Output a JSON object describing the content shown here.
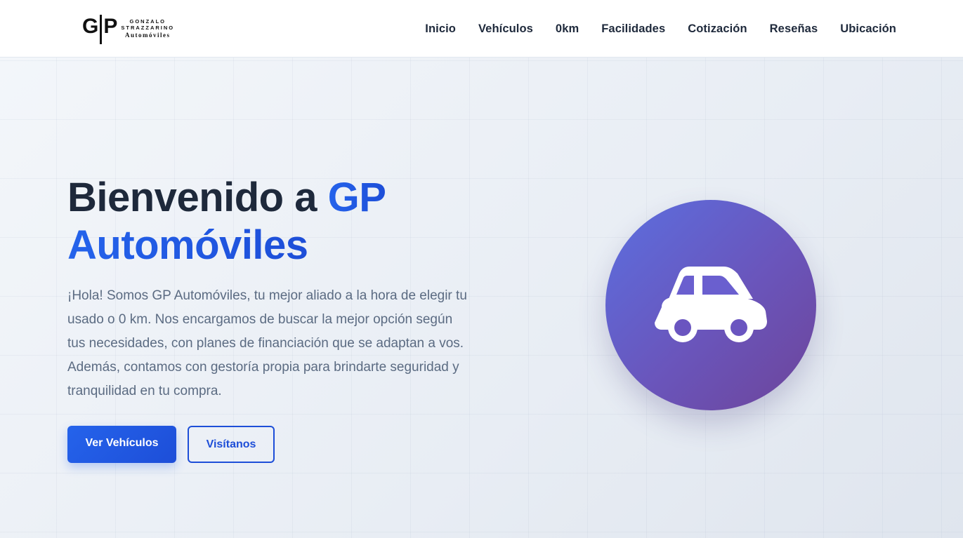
{
  "brand": {
    "mark_g": "G",
    "mark_p": "P",
    "line1": "GONZALO",
    "line2": "STRAZZARINO",
    "line3": "Automóviles"
  },
  "nav": {
    "items": [
      {
        "label": "Inicio"
      },
      {
        "label": "Vehículos"
      },
      {
        "label": "0km"
      },
      {
        "label": "Facilidades"
      },
      {
        "label": "Cotización"
      },
      {
        "label": "Reseñas"
      },
      {
        "label": "Ubicación"
      }
    ]
  },
  "hero": {
    "title_prefix": "Bienvenido a ",
    "title_accent_1": "GP",
    "title_accent_2": "Automóviles",
    "description": "¡Hola! Somos GP Automóviles, tu mejor aliado a la hora de elegir tu usado o 0 km. Nos encargamos de buscar la mejor opción según tus necesidades, con planes de financiación que se adaptan a vos. Además, contamos con gestoría propia para brindarte seguridad y tranquilidad en tu compra.",
    "primary_button": "Ver Vehículos",
    "secondary_button": "Visítanos",
    "icon": "car-icon"
  },
  "colors": {
    "accent": "#1d4ed8",
    "text_dark": "#1e293b",
    "text_muted": "#5b6b82",
    "circle_start": "#5b6fe0",
    "circle_end": "#6d4499"
  }
}
